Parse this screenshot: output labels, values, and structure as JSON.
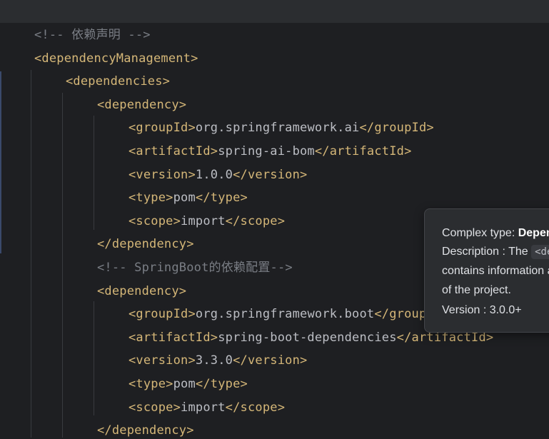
{
  "colors": {
    "background": "#1e1f22",
    "tag": "#d5b778",
    "text": "#bcbec4",
    "comment": "#7a7e85",
    "tooltip_background": "#2b2d30"
  },
  "code": {
    "lines": [
      {
        "parts": [
          {
            "t": "<!-- 依赖声明 -->",
            "c": "cmt"
          }
        ]
      },
      {
        "parts": [
          {
            "t": "<dependencyManagement>",
            "c": "tag"
          }
        ]
      },
      {
        "parts": [
          {
            "t": "<dependencies>",
            "c": "tag"
          }
        ]
      },
      {
        "parts": [
          {
            "t": "<dependency>",
            "c": "tag"
          }
        ]
      },
      {
        "parts": [
          {
            "t": "<groupId>",
            "c": "tag"
          },
          {
            "t": "org.springframework.ai",
            "c": "txt"
          },
          {
            "t": "</groupId>",
            "c": "tag"
          }
        ]
      },
      {
        "parts": [
          {
            "t": "<artifactId>",
            "c": "tag"
          },
          {
            "t": "spring-ai-bom",
            "c": "txt"
          },
          {
            "t": "</artifactId>",
            "c": "tag"
          }
        ]
      },
      {
        "parts": [
          {
            "t": "<version>",
            "c": "tag"
          },
          {
            "t": "1.0.0",
            "c": "txt"
          },
          {
            "t": "</version>",
            "c": "tag"
          }
        ]
      },
      {
        "parts": [
          {
            "t": "<type>",
            "c": "tag"
          },
          {
            "t": "pom",
            "c": "txt"
          },
          {
            "t": "</type>",
            "c": "tag"
          }
        ]
      },
      {
        "parts": [
          {
            "t": "<scope>",
            "c": "tag"
          },
          {
            "t": "import",
            "c": "txt"
          },
          {
            "t": "</scope>",
            "c": "tag"
          }
        ]
      },
      {
        "parts": [
          {
            "t": "</dependency>",
            "c": "tag"
          }
        ]
      },
      {
        "parts": [
          {
            "t": "<!-- SpringBoot的依赖配置-->",
            "c": "cmt"
          }
        ]
      },
      {
        "parts": [
          {
            "t": "<dependency>",
            "c": "tag"
          }
        ]
      },
      {
        "parts": [
          {
            "t": "<groupId>",
            "c": "tag"
          },
          {
            "t": "org.springframework.boot",
            "c": "txt"
          },
          {
            "t": "</groupId>",
            "c": "tag"
          }
        ]
      },
      {
        "parts": [
          {
            "t": "<artifactId>",
            "c": "tag"
          },
          {
            "t": "spring-boot-dependencies",
            "c": "txt"
          },
          {
            "t": "</artifactId>",
            "c": "tag"
          }
        ]
      },
      {
        "parts": [
          {
            "t": "<version>",
            "c": "tag"
          },
          {
            "t": "3.3.0",
            "c": "txt"
          },
          {
            "t": "</version>",
            "c": "tag"
          }
        ]
      },
      {
        "parts": [
          {
            "t": "<type>",
            "c": "tag"
          },
          {
            "t": "pom",
            "c": "txt"
          },
          {
            "t": "</type>",
            "c": "tag"
          }
        ]
      },
      {
        "parts": [
          {
            "t": "<scope>",
            "c": "tag"
          },
          {
            "t": "import",
            "c": "txt"
          },
          {
            "t": "</scope>",
            "c": "tag"
          }
        ]
      },
      {
        "parts": [
          {
            "t": "</dependency>",
            "c": "tag"
          }
        ]
      }
    ]
  },
  "tooltip": {
    "complex_type_label": "Complex type: ",
    "complex_type_value": "Dependency",
    "description_label": "Description : The ",
    "description_code": "<dependency>",
    "description_line2": "contains information about a dependency",
    "description_line3": "of the project.",
    "version": "Version : 3.0.0+"
  }
}
